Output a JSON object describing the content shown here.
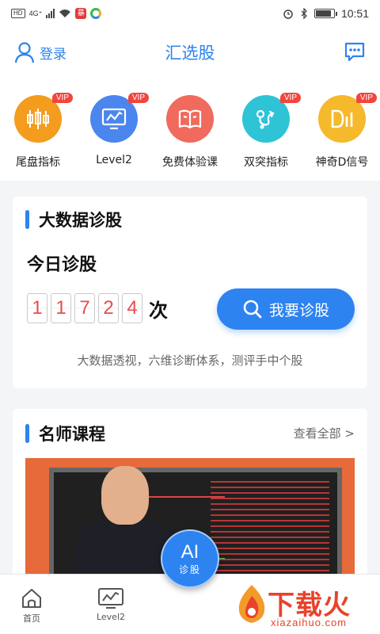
{
  "status_bar": {
    "badge_hd": "HD",
    "network": "4G⁺",
    "app_badge": "暴",
    "time": "10:51",
    "battery_level": 0.85
  },
  "header": {
    "login_label": "登录",
    "title": "汇选股"
  },
  "quick_icons": [
    {
      "label": "尾盘指标",
      "vip": "VIP",
      "icon": "candlestick-icon",
      "color": "#f39c1e"
    },
    {
      "label": "Level2",
      "vip": "VIP",
      "icon": "monitor-chart-icon",
      "color": "#4b86ee"
    },
    {
      "label": "免费体验课",
      "vip": "",
      "icon": "open-book-icon",
      "color": "#f06b5d"
    },
    {
      "label": "双突指标",
      "vip": "VIP",
      "icon": "breakout-path-icon",
      "color": "#2fc3d6"
    },
    {
      "label": "神奇D信号",
      "vip": "VIP",
      "icon": "d-signal-icon",
      "color": "#f5b92c"
    }
  ],
  "big_data": {
    "title": "大数据诊股",
    "today_label": "今日诊股",
    "digits": [
      "1",
      "1",
      "7",
      "2",
      "4"
    ],
    "count_unit": "次",
    "button_label": "我要诊股",
    "description": "大数据透视，六维诊断体系，测评手中个股"
  },
  "courses": {
    "title": "名师课程",
    "more_label": "查看全部 >"
  },
  "tab_bar": {
    "home_label": "首页",
    "level2_label": "Level2",
    "ai_main": "AI",
    "ai_sub": "诊股"
  },
  "watermark": {
    "text": "下载火",
    "url": "xiazaihuo.com"
  },
  "colors": {
    "accent": "#2d83f0",
    "vip_badge": "#f2453d",
    "digit": "#e94b4b"
  }
}
